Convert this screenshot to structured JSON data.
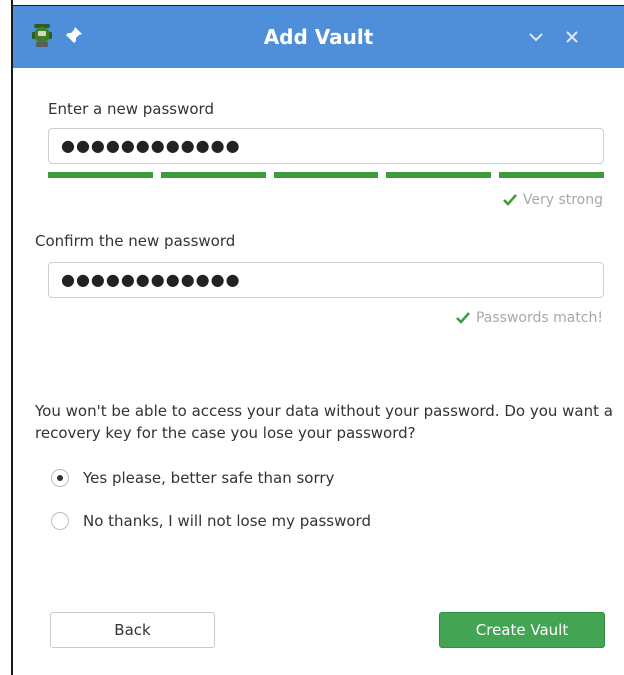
{
  "window": {
    "title": "Add Vault",
    "icons": {
      "app": "cryptomator-bot-icon",
      "pin": "pin-icon",
      "minimize": "chevron-down-icon",
      "close": "close-icon"
    },
    "titlebar_color": "#4f8fd9"
  },
  "password": {
    "label": "Enter a new password",
    "value": "●●●●●●●●●●●●",
    "strength_segments_filled": 5,
    "strength_segments_total": 5,
    "strength_color": "#3d9a3d",
    "strength_text": "Very strong"
  },
  "confirm": {
    "label": "Confirm the new password",
    "value": "●●●●●●●●●●●●",
    "match_text": "Passwords match!"
  },
  "recovery": {
    "question": "You won't be able to access your data without your password. Do you want a recovery key for the case you lose your password?",
    "options": [
      {
        "label": "Yes please, better safe than sorry",
        "selected": true
      },
      {
        "label": "No thanks, I will not lose my password",
        "selected": false
      }
    ]
  },
  "buttons": {
    "back": "Back",
    "create": "Create Vault",
    "create_color": "#43a553"
  }
}
